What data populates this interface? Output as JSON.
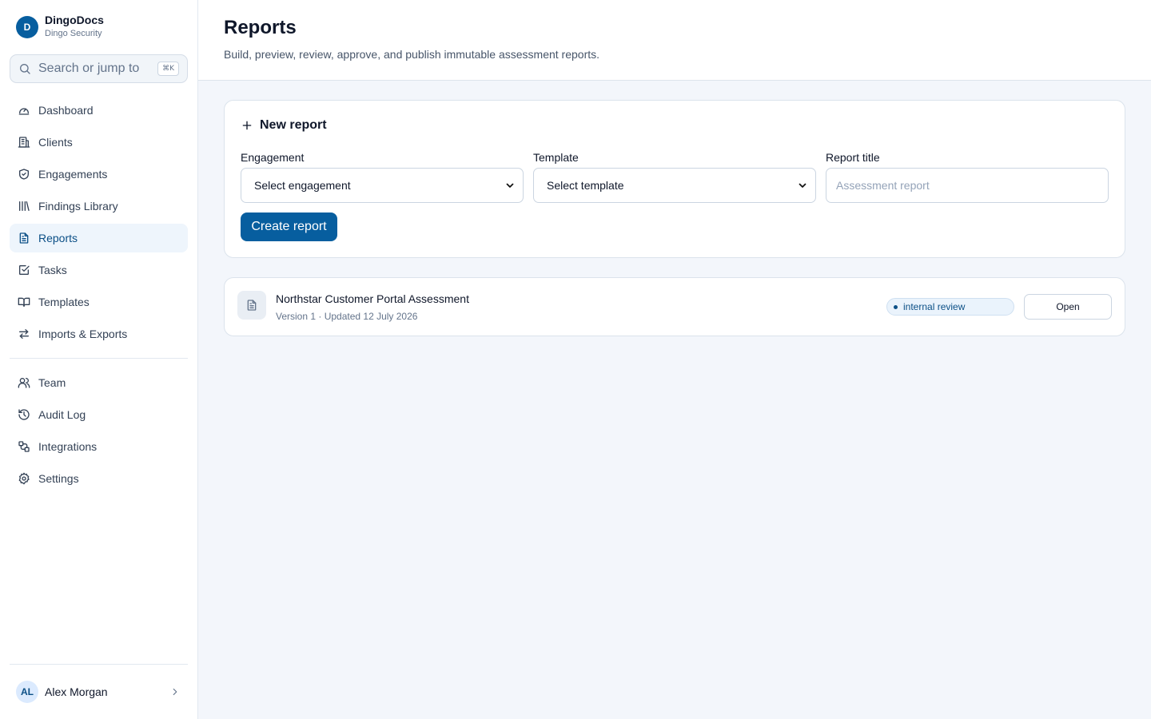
{
  "brand": {
    "logo": "D",
    "name": "DingoDocs",
    "org": "Dingo Security"
  },
  "search": {
    "placeholder": "Search or jump to",
    "shortcut": "⌘K",
    "icon": "search-icon"
  },
  "nav_primary": [
    {
      "label": "Dashboard",
      "icon": "gauge-icon",
      "active": false
    },
    {
      "label": "Clients",
      "icon": "building-icon",
      "active": false
    },
    {
      "label": "Engagements",
      "icon": "shield-icon",
      "active": false
    },
    {
      "label": "Findings Library",
      "icon": "library-icon",
      "active": false
    },
    {
      "label": "Reports",
      "icon": "file-text-icon",
      "active": true
    },
    {
      "label": "Tasks",
      "icon": "checkbox-icon",
      "active": false
    },
    {
      "label": "Templates",
      "icon": "book-icon",
      "active": false
    },
    {
      "label": "Imports & Exports",
      "icon": "arrows-swap-icon",
      "active": false
    }
  ],
  "nav_secondary": [
    {
      "label": "Team",
      "icon": "users-icon",
      "active": false
    },
    {
      "label": "Audit Log",
      "icon": "history-icon",
      "active": false
    },
    {
      "label": "Integrations",
      "icon": "workflow-icon",
      "active": false
    },
    {
      "label": "Settings",
      "icon": "gear-icon",
      "active": false
    }
  ],
  "user": {
    "initials": "AL",
    "name": "Alex Morgan"
  },
  "header": {
    "title": "Reports",
    "subtitle": "Build, preview, review, approve, and publish immutable assessment reports."
  },
  "new_report": {
    "title": "New report",
    "engagement": {
      "label": "Engagement",
      "value": "Select engagement"
    },
    "template": {
      "label": "Template",
      "value": "Select template"
    },
    "report_title": {
      "label": "Report title",
      "placeholder": "Assessment report"
    },
    "create_label": "Create report"
  },
  "reports": [
    {
      "title": "Northstar Customer Portal Assessment",
      "meta": "Version 1 · Updated 12 July 2026",
      "status": "internal review",
      "open_label": "Open"
    }
  ],
  "colors": {
    "accent": "#075e9f",
    "active_bg": "#eef5fc",
    "status_text": "#0b4f86"
  }
}
